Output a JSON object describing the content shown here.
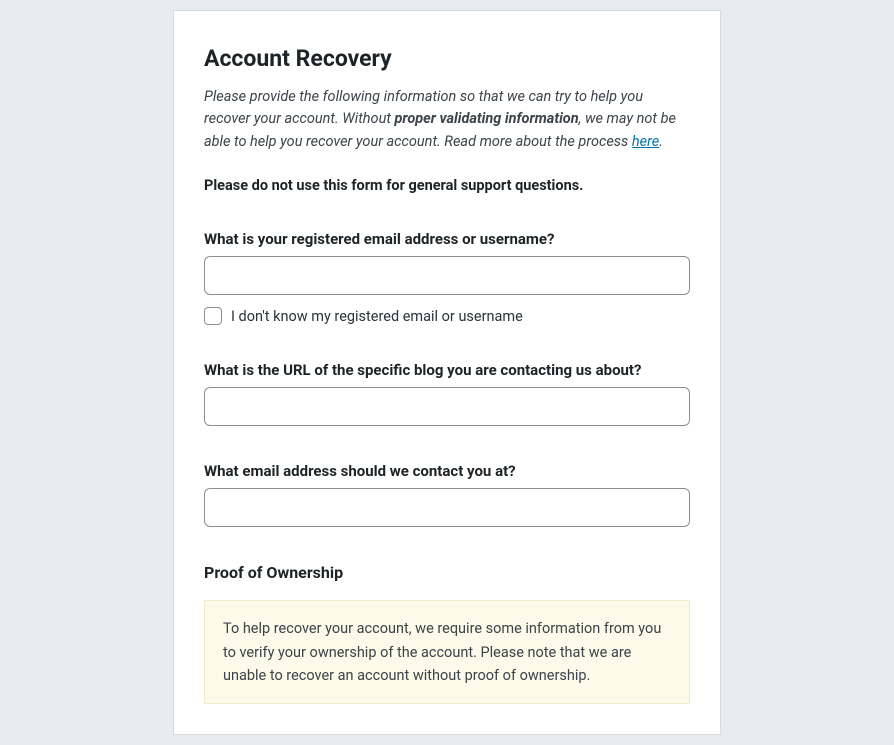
{
  "heading": "Account Recovery",
  "intro": {
    "pre": "Please provide the following information so that we can try to help you recover your account. Without ",
    "bold": "proper validating information",
    "mid": ", we may not be able to help you recover your account. Read more about the process ",
    "link": "here",
    "post": "."
  },
  "warning": "Please do not use this form for general support questions.",
  "fields": {
    "email_or_username": {
      "label": "What is your registered email address or username?",
      "value": ""
    },
    "unknown_checkbox": {
      "label": "I don't know my registered email or username"
    },
    "blog_url": {
      "label": "What is the URL of the specific blog you are contacting us about?",
      "value": ""
    },
    "contact_email": {
      "label": "What email address should we contact you at?",
      "value": ""
    }
  },
  "proof": {
    "heading": "Proof of Ownership",
    "notice": "To help recover your account, we require some information from you to verify your ownership of the account. Please note that we are unable to recover an account without proof of ownership."
  }
}
